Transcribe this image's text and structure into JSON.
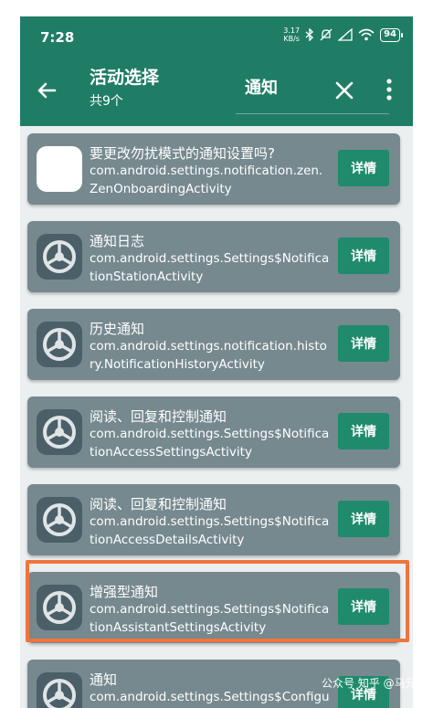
{
  "status": {
    "time": "7:28",
    "speed_value": "3.17",
    "speed_unit": "KB/s",
    "battery": "94"
  },
  "appbar": {
    "title": "活动选择",
    "subtitle": "共9个",
    "search_value": "通知"
  },
  "items": [
    {
      "title": "要更改勿扰模式的通知设置吗?",
      "subtitle": "com.android.settings.notification.zen.ZenOnboardingActivity",
      "button": "详情",
      "icon": "blank-app-icon"
    },
    {
      "title": "通知日志",
      "subtitle": "com.android.settings.Settings$NotificationStationActivity",
      "button": "详情",
      "icon": "settings-gear-icon"
    },
    {
      "title": "历史通知",
      "subtitle": "com.android.settings.notification.history.NotificationHistoryActivity",
      "button": "详情",
      "icon": "settings-gear-icon"
    },
    {
      "title": "阅读、回复和控制通知",
      "subtitle": "com.android.settings.Settings$NotificationAccessSettingsActivity",
      "button": "详情",
      "icon": "settings-gear-icon"
    },
    {
      "title": "阅读、回复和控制通知",
      "subtitle": "com.android.settings.Settings$NotificationAccessDetailsActivity",
      "button": "详情",
      "icon": "settings-gear-icon"
    },
    {
      "title": "增强型通知",
      "subtitle": "com.android.settings.Settings$NotificationAssistantSettingsActivity",
      "button": "详情",
      "icon": "settings-gear-icon"
    },
    {
      "title": "通知",
      "subtitle": "com.android.settings.Settings$ConfigureNotificationSettingsActivity",
      "button": "详情",
      "icon": "settings-gear-icon"
    }
  ],
  "watermark": "公众号 知乎 @马元鹏",
  "colors": {
    "appbar": "#1f7d66",
    "card": "#76898e",
    "button": "#1f8b6c",
    "highlight": "#f0743c",
    "background": "#eceff0"
  }
}
